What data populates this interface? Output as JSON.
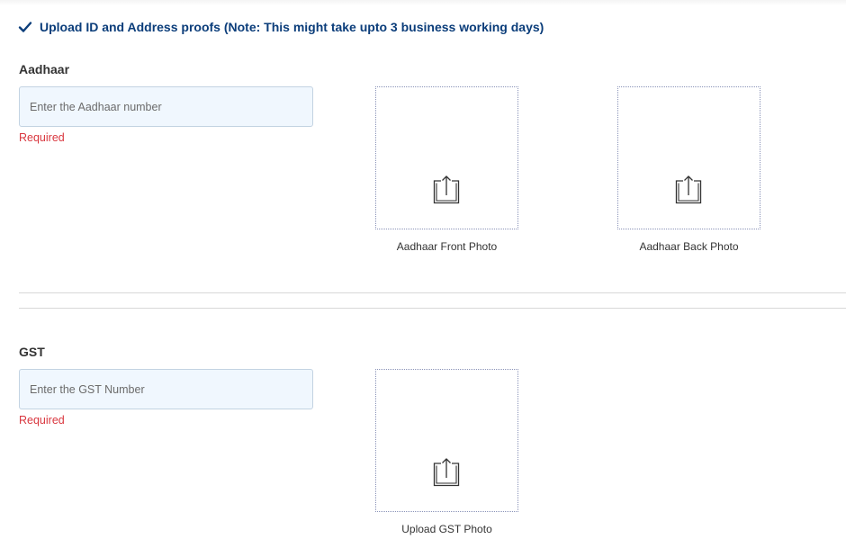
{
  "header": {
    "title": "Upload ID and Address proofs (Note: This might take upto 3 business working days)",
    "icon": "check-icon",
    "color": "#0b3d7a"
  },
  "aadhaar": {
    "label": "Aadhaar",
    "input_value": "",
    "placeholder": "Enter the Aadhaar number",
    "error": "Required",
    "front_caption": "Aadhaar Front Photo",
    "back_caption": "Aadhaar Back Photo",
    "upload_icon": "upload-icon"
  },
  "gst": {
    "label": "GST",
    "input_value": "",
    "placeholder": "Enter the GST Number",
    "error": "Required",
    "photo_caption": "Upload GST Photo",
    "upload_icon": "upload-icon"
  },
  "colors": {
    "error": "#d9363e",
    "input_bg": "#f0f7fe",
    "input_border": "#c3d3e2"
  }
}
